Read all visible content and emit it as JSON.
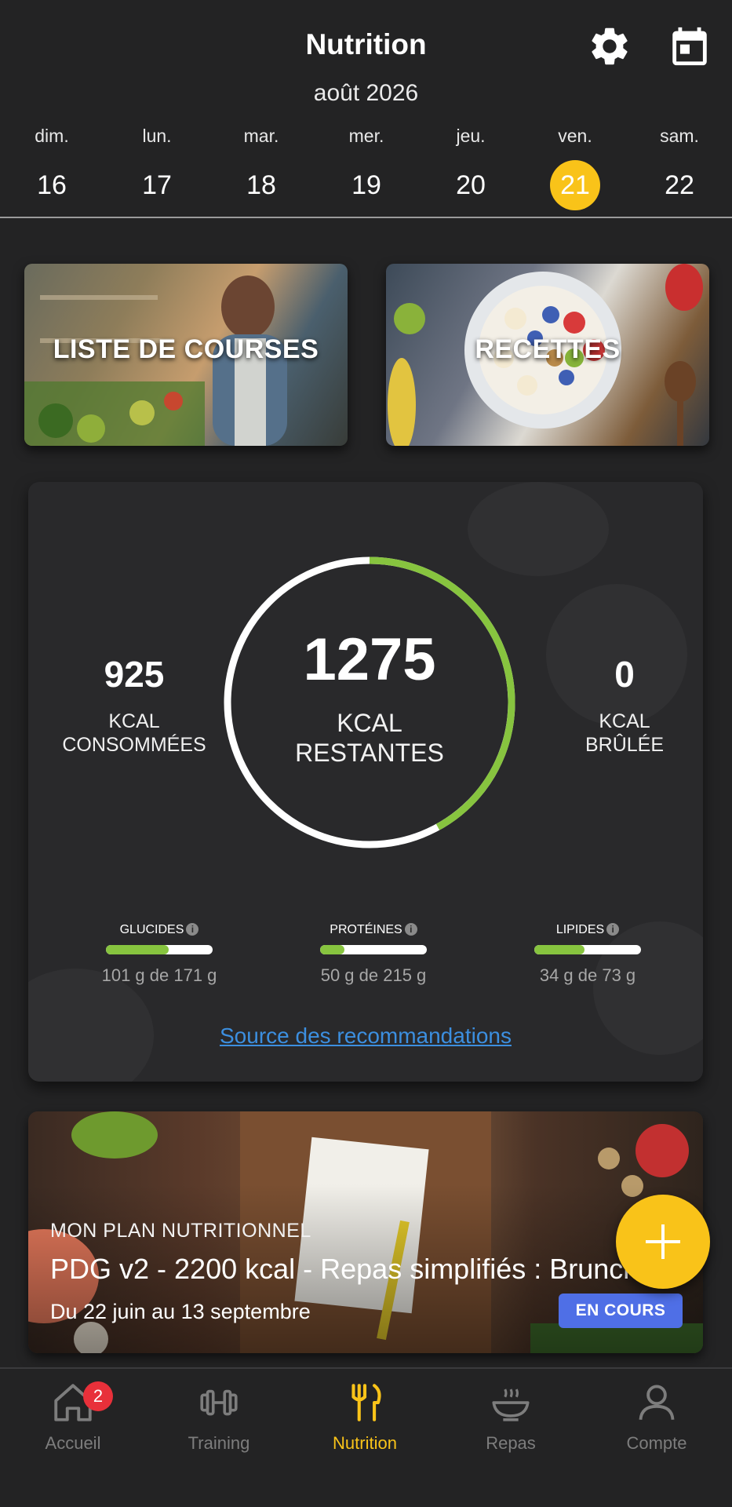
{
  "header": {
    "title": "Nutrition",
    "month": "août 2026",
    "settings_icon": "gear-icon",
    "calendar_icon": "calendar-icon"
  },
  "week": {
    "days": [
      {
        "name": "dim.",
        "num": "16"
      },
      {
        "name": "lun.",
        "num": "17"
      },
      {
        "name": "mar.",
        "num": "18"
      },
      {
        "name": "mer.",
        "num": "19"
      },
      {
        "name": "jeu.",
        "num": "20"
      },
      {
        "name": "ven.",
        "num": "21"
      },
      {
        "name": "sam.",
        "num": "22"
      }
    ],
    "selected_day": "21"
  },
  "tiles": {
    "shopping_label": "LISTE DE COURSES",
    "recipes_label": "RECETTES"
  },
  "calories": {
    "consumed_value": "925",
    "consumed_label_1": "KCAL",
    "consumed_label_2": "CONSOMMÉES",
    "remaining_value": "1275",
    "remaining_label_1": "KCAL",
    "remaining_label_2": "RESTANTES",
    "burned_value": "0",
    "burned_label_1": "KCAL",
    "burned_label_2": "BRÛLÉE",
    "ring_progress_fraction": 0.42
  },
  "macros": [
    {
      "name": "GLUCIDES",
      "amount": "101 g de 171 g",
      "fraction": 0.59
    },
    {
      "name": "PROTÉINES",
      "amount": "50 g de 215 g",
      "fraction": 0.23
    },
    {
      "name": "LIPIDES",
      "amount": "34 g de 73 g",
      "fraction": 0.47
    }
  ],
  "source_link": "Source des recommandations",
  "plan": {
    "kicker": "MON PLAN NUTRITIONNEL",
    "title": "PDG v2 - 2200 kcal - Repas simplifiés : Brunch",
    "dates": "Du 22 juin au 13 septembre",
    "status": "EN COURS"
  },
  "colors": {
    "accent": "#f9c319",
    "progress_green": "#87c43f",
    "link_blue": "#3c8fe0",
    "badge_blue": "#4f6fe6",
    "notification_red": "#e8303a"
  },
  "nav": {
    "items": [
      {
        "label": "Accueil",
        "icon": "home-icon",
        "badge": "2"
      },
      {
        "label": "Training",
        "icon": "dumbbell-icon"
      },
      {
        "label": "Nutrition",
        "icon": "fork-knife-icon"
      },
      {
        "label": "Repas",
        "icon": "bowl-icon"
      },
      {
        "label": "Compte",
        "icon": "user-icon"
      }
    ],
    "active": "Nutrition"
  }
}
